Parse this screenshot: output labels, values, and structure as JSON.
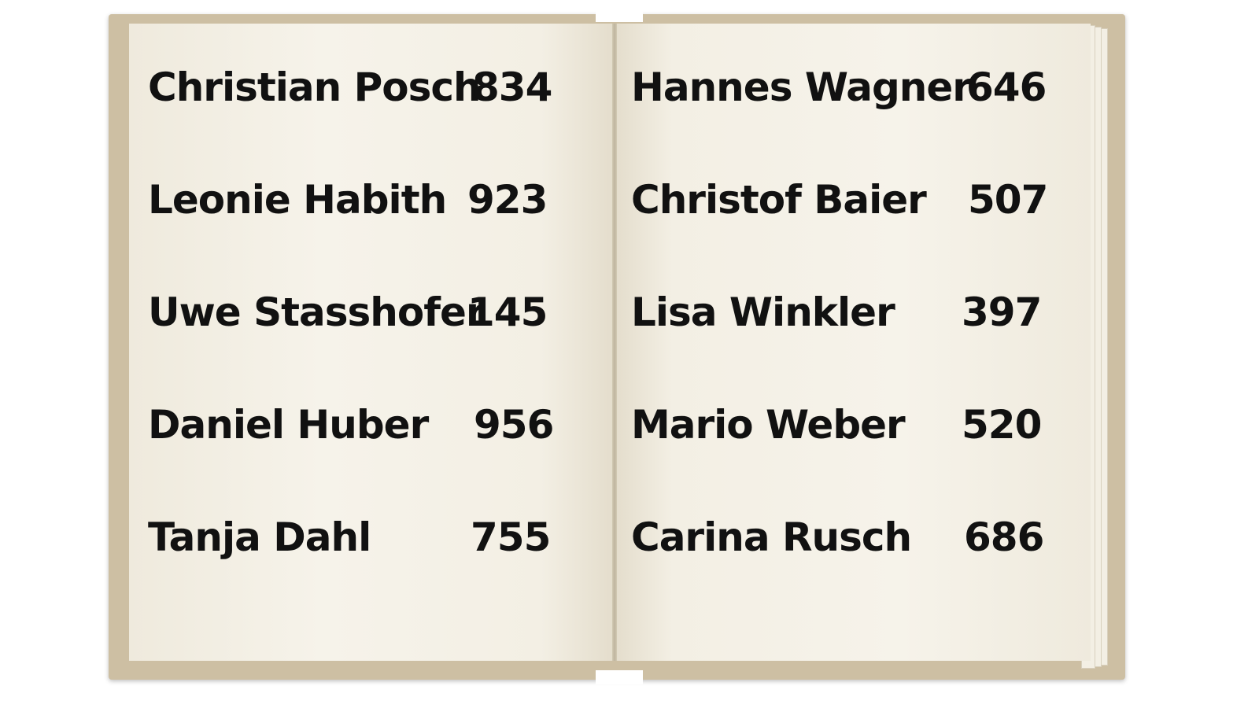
{
  "left_page": {
    "entries": [
      {
        "name": "Christian Posch",
        "value": "834"
      },
      {
        "name": "Leonie Habith",
        "value": "923"
      },
      {
        "name": "Uwe Stasshofer",
        "value": "145"
      },
      {
        "name": "Daniel Huber",
        "value": "956"
      },
      {
        "name": "Tanja Dahl",
        "value": "755"
      }
    ]
  },
  "right_page": {
    "entries": [
      {
        "name": "Hannes Wagner",
        "value": "646"
      },
      {
        "name": "Christof Baier",
        "value": "507"
      },
      {
        "name": "Lisa Winkler",
        "value": "397"
      },
      {
        "name": "Mario Weber",
        "value": "520"
      },
      {
        "name": "Carina Rusch",
        "value": "686"
      }
    ]
  },
  "colors": {
    "cover": "#cdbfa3",
    "paper": "#f6f3ea",
    "text": "#111111"
  }
}
